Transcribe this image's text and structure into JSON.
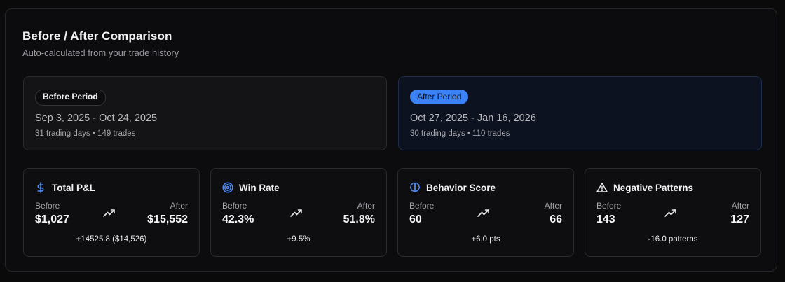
{
  "header": {
    "title": "Before / After Comparison",
    "subtitle": "Auto-calculated from your trade history"
  },
  "periods": {
    "before": {
      "label": "Before Period",
      "range": "Sep 3, 2025 - Oct 24, 2025",
      "meta": "31 trading days • 149 trades"
    },
    "after": {
      "label": "After Period",
      "range": "Oct 27, 2025 - Jan 16, 2026",
      "meta": "30 trading days • 110 trades",
      "accent": "#3b82f6"
    }
  },
  "metrics": [
    {
      "title": "Total P&L",
      "icon": "dollar-icon",
      "before_label": "Before",
      "after_label": "After",
      "before": "$1,027",
      "after": "$15,552",
      "delta": "+14525.8 ($14,526)"
    },
    {
      "title": "Win Rate",
      "icon": "target-icon",
      "before_label": "Before",
      "after_label": "After",
      "before": "42.3%",
      "after": "51.8%",
      "delta": "+9.5%"
    },
    {
      "title": "Behavior Score",
      "icon": "brain-icon",
      "before_label": "Before",
      "after_label": "After",
      "before": "60",
      "after": "66",
      "delta": "+6.0 pts"
    },
    {
      "title": "Negative Patterns",
      "icon": "warning-icon",
      "before_label": "Before",
      "after_label": "After",
      "before": "143",
      "after": "127",
      "delta": "-16.0 patterns"
    }
  ]
}
